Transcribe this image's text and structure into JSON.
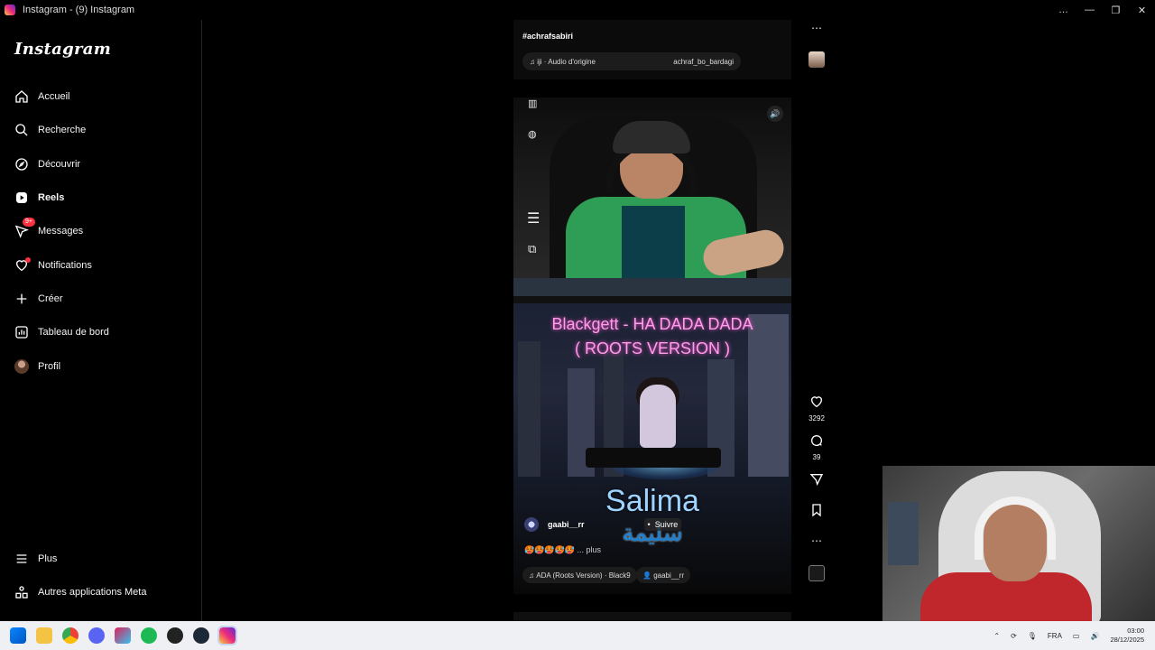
{
  "window": {
    "title": "Instagram - (9) Instagram",
    "controls": [
      "…",
      "—",
      "❐",
      "✕"
    ]
  },
  "sidebar": {
    "logo": "Instagram",
    "items": [
      {
        "label": "Accueil",
        "icon": "home-icon"
      },
      {
        "label": "Recherche",
        "icon": "search-icon"
      },
      {
        "label": "Découvrir",
        "icon": "compass-icon"
      },
      {
        "label": "Reels",
        "icon": "reels-icon",
        "active": true
      },
      {
        "label": "Messages",
        "icon": "messenger-icon",
        "badge": "9+"
      },
      {
        "label": "Notifications",
        "icon": "heart-icon"
      },
      {
        "label": "Créer",
        "icon": "plus-icon"
      },
      {
        "label": "Tableau de bord",
        "icon": "dashboard-icon"
      },
      {
        "label": "Profil",
        "icon": "avatar"
      }
    ],
    "bottom_items": [
      {
        "label": "Plus",
        "icon": "menu-icon"
      },
      {
        "label": "Autres applications Meta",
        "icon": "meta-apps-icon"
      }
    ]
  },
  "previous_post": {
    "hashtag": "#achrafsabiri",
    "audio": "iji · Audio d'origine",
    "author": "achraf_bo_bardagi"
  },
  "reel": {
    "song_title_line1": "Blackgett - HA DADA DADA",
    "song_title_line2": "( ROOTS VERSION )",
    "overlay_name": "Salima",
    "overlay_arabic": "سليمة",
    "username": "gaabi__rr",
    "separator": "•",
    "follow_label": "Suivre",
    "caption": "🥵🥵🥵🥵🥵 ... plus",
    "audio_pill": "ADA (Roots Version) · Black9",
    "user_pill": "gaabi__rr"
  },
  "actions": {
    "likes": "3292",
    "comments": "39"
  },
  "taskbar": {
    "lang": "FRA",
    "time": "03:00",
    "date": "28/12/2025"
  }
}
